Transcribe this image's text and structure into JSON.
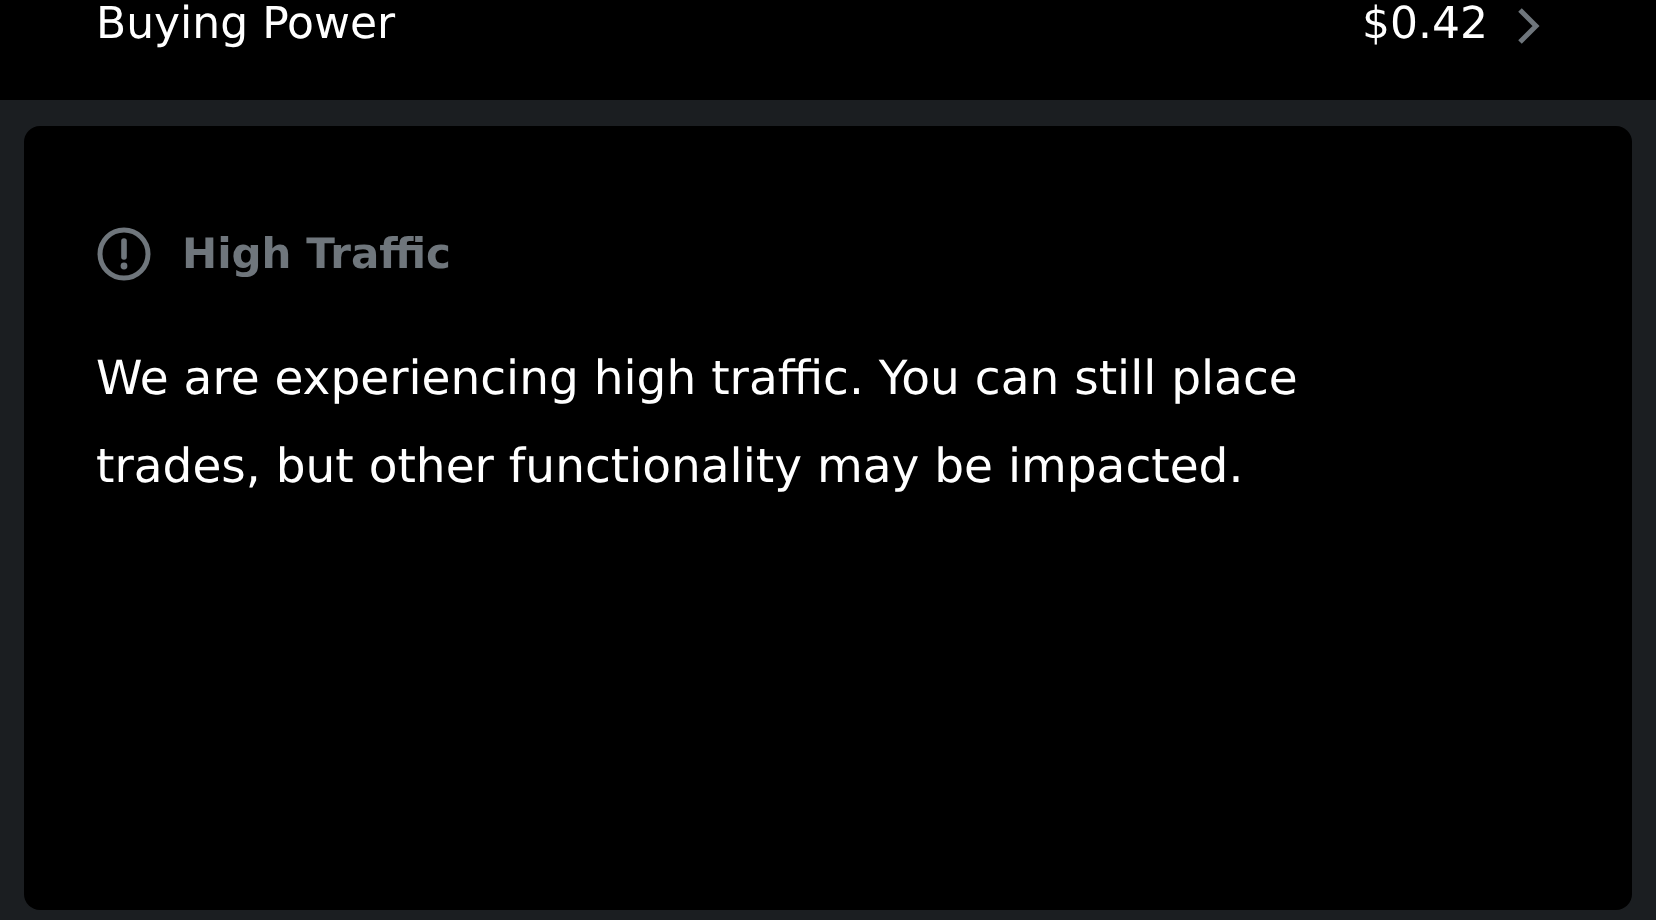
{
  "account_row": {
    "label": "Buying Power",
    "value": "$0.42"
  },
  "alert": {
    "title": "High Traffic",
    "message": "We are experiencing high traffic. You can still place trades, but other functionality may be impacted."
  }
}
